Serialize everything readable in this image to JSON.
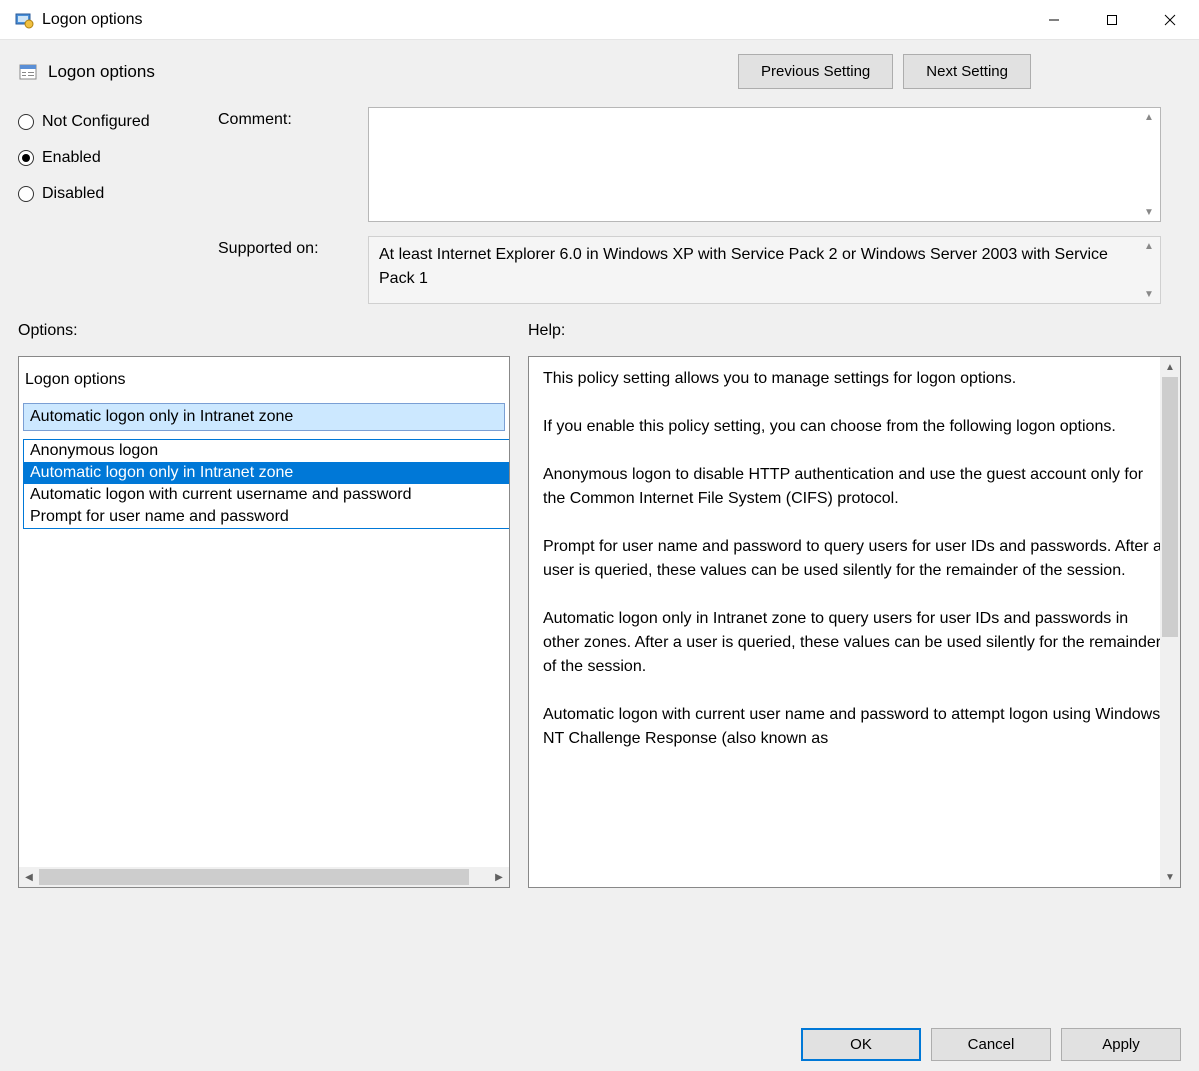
{
  "titlebar": {
    "title": "Logon options"
  },
  "header": {
    "title": "Logon options",
    "prev_button": "Previous Setting",
    "next_button": "Next Setting"
  },
  "state_radios": {
    "not_configured": "Not Configured",
    "enabled": "Enabled",
    "disabled": "Disabled",
    "selected": "enabled"
  },
  "comment": {
    "label": "Comment:",
    "value": ""
  },
  "supported": {
    "label": "Supported on:",
    "value": "At least Internet Explorer 6.0 in Windows XP with Service Pack 2 or Windows Server 2003 with Service Pack 1"
  },
  "sections": {
    "options": "Options:",
    "help": "Help:"
  },
  "options_panel": {
    "heading": "Logon options",
    "selected": "Automatic logon only in Intranet zone",
    "dropdown": {
      "items": [
        "Anonymous logon",
        "Automatic logon only in Intranet zone",
        "Automatic logon with current username and password",
        "Prompt for user name and password"
      ],
      "highlighted_index": 1
    }
  },
  "help_text": "This policy setting allows you to manage settings for logon options.\n\nIf you enable this policy setting, you can choose from the following logon options.\n\nAnonymous logon to disable HTTP authentication and use the guest account only for the Common Internet File System (CIFS) protocol.\n\nPrompt for user name and password to query users for user IDs and passwords. After a user is queried, these values can be used silently for the remainder of the session.\n\nAutomatic logon only in Intranet zone to query users for user IDs and passwords in other zones. After a user is queried, these values can be used silently for the remainder of the session.\n\nAutomatic logon with current user name and password to attempt logon using Windows NT Challenge Response (also known as",
  "footer": {
    "ok": "OK",
    "cancel": "Cancel",
    "apply": "Apply"
  }
}
